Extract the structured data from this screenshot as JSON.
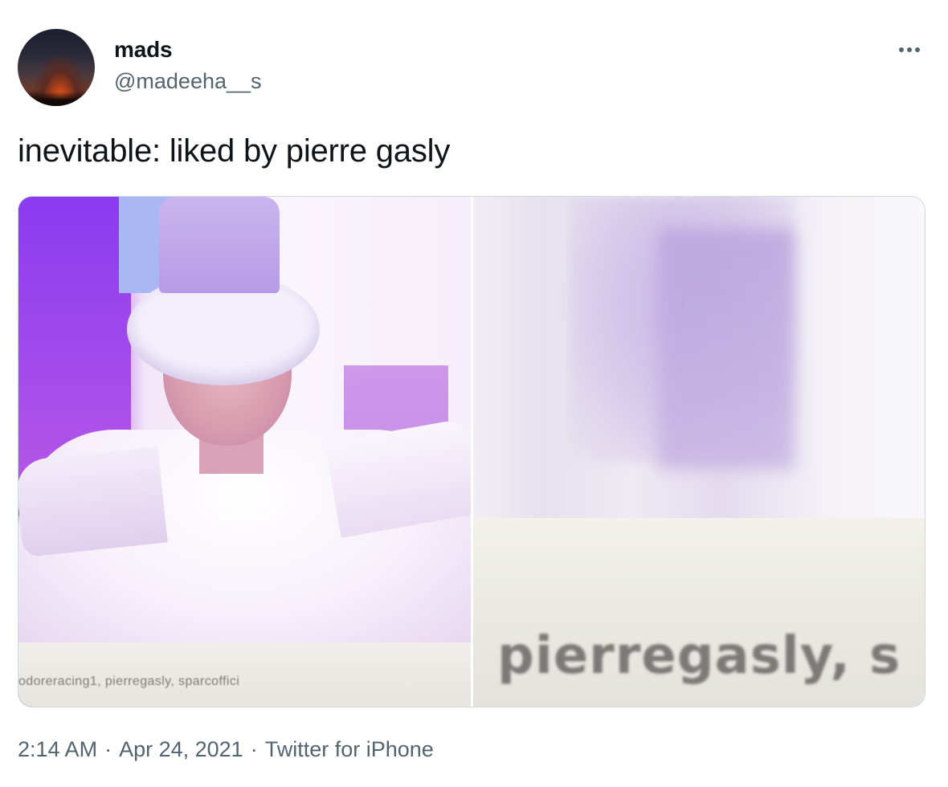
{
  "author": {
    "display_name": "mads",
    "handle": "@madeeha__s"
  },
  "tweet": {
    "text": "inevitable: liked by pierre gasly"
  },
  "media": {
    "left_image_caption": "odoreracing1, pierregasly, sparcoffici",
    "right_image_caption": "pierregasly, s"
  },
  "metadata": {
    "time": "2:14 AM",
    "date": "Apr 24, 2021",
    "source": "Twitter for iPhone",
    "separator": "·"
  },
  "icons": {
    "more": "more-horizontal-icon"
  },
  "colors": {
    "primary_text": "#0f1419",
    "secondary_text": "#536471",
    "border": "#cfd9de"
  }
}
